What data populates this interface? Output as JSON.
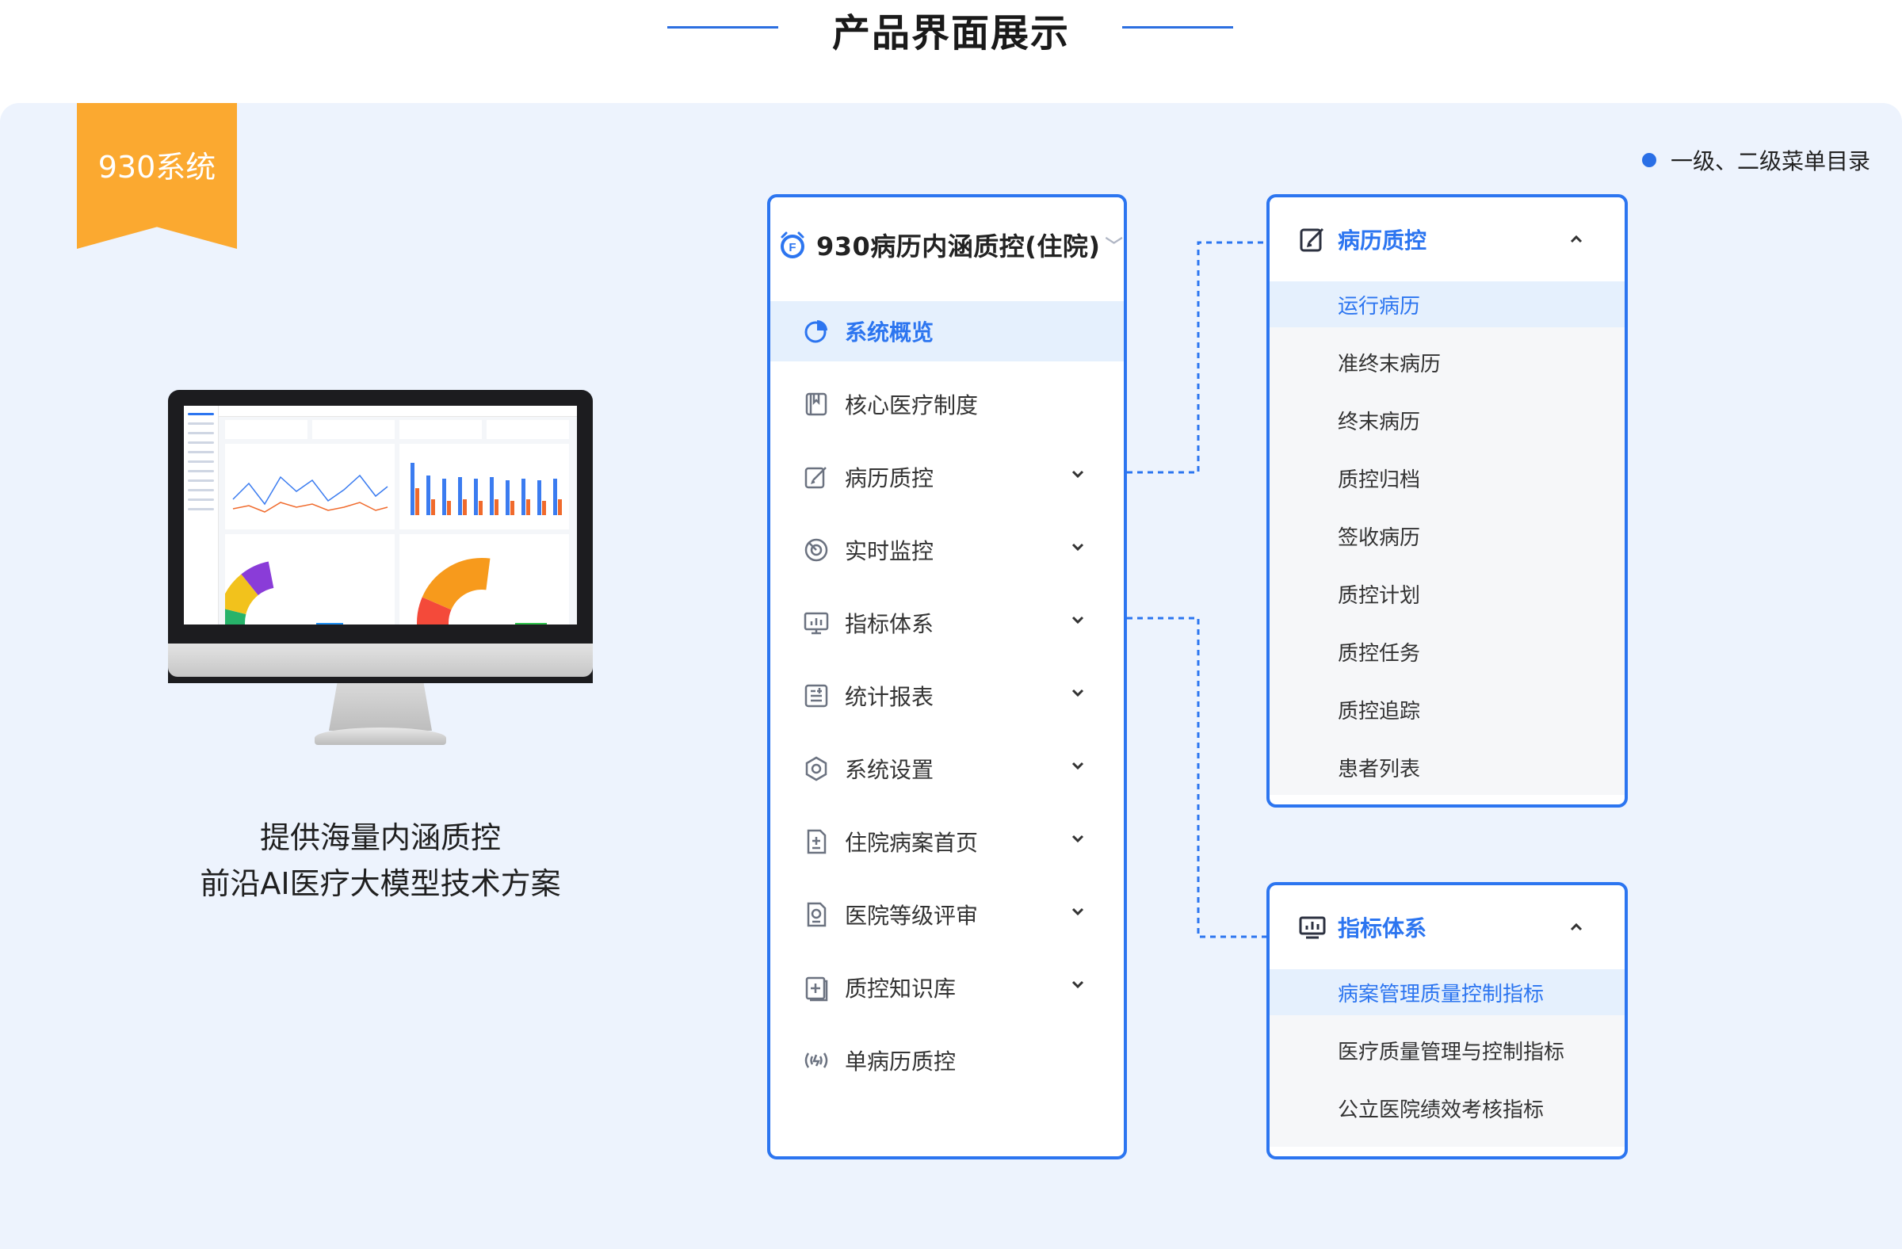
{
  "page_title": "产品界面展示",
  "badge": "930系统",
  "legend": "一级、二级菜单目录",
  "caption": {
    "line1": "提供海量内涵质控",
    "line2": "前沿AI医疗大模型技术方案"
  },
  "main_menu": {
    "title": "930病历内涵质控(住院)",
    "items": [
      {
        "label": "系统概览",
        "icon": "pie-chart-icon",
        "active": true,
        "expandable": false
      },
      {
        "label": "核心医疗制度",
        "icon": "book-icon",
        "active": false,
        "expandable": false
      },
      {
        "label": "病历质控",
        "icon": "edit-icon",
        "active": false,
        "expandable": true
      },
      {
        "label": "实时监控",
        "icon": "monitor-icon",
        "active": false,
        "expandable": true
      },
      {
        "label": "指标体系",
        "icon": "indicator-icon",
        "active": false,
        "expandable": true
      },
      {
        "label": "统计报表",
        "icon": "report-icon",
        "active": false,
        "expandable": true
      },
      {
        "label": "系统设置",
        "icon": "settings-icon",
        "active": false,
        "expandable": true
      },
      {
        "label": "住院病案首页",
        "icon": "record-icon",
        "active": false,
        "expandable": true
      },
      {
        "label": "医院等级评审",
        "icon": "review-icon",
        "active": false,
        "expandable": true
      },
      {
        "label": "质控知识库",
        "icon": "knowledge-icon",
        "active": false,
        "expandable": true
      },
      {
        "label": "单病历质控",
        "icon": "signal-icon",
        "active": false,
        "expandable": false
      }
    ]
  },
  "submenu_medical_record": {
    "title": "病历质控",
    "items": [
      "运行病历",
      "准终末病历",
      "终末病历",
      "质控归档",
      "签收病历",
      "质控计划",
      "质控任务",
      "质控追踪",
      "患者列表"
    ],
    "active_index": 0
  },
  "submenu_indicator": {
    "title": "指标体系",
    "items": [
      "病案管理质量控制指标",
      "医疗质量管理与控制指标",
      "公立医院绩效考核指标"
    ],
    "active_index": 0
  },
  "colors": {
    "accent": "#2c75f0",
    "badge": "#fba930",
    "panel": "#edf3fd",
    "active_bg": "#e5f0fd"
  }
}
